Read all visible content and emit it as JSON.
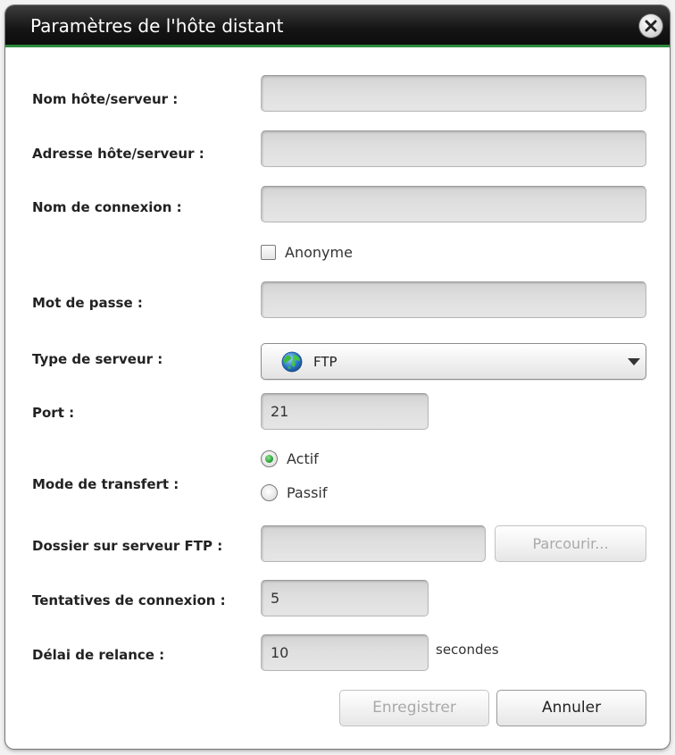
{
  "dialog": {
    "title": "Paramètres de l'hôte distant"
  },
  "form": {
    "host_name_label": "Nom hôte/serveur :",
    "host_name_value": "",
    "host_address_label": "Adresse hôte/serveur :",
    "host_address_value": "",
    "login_name_label": "Nom de connexion :",
    "login_name_value": "",
    "anonymous_label": "Anonyme",
    "anonymous_checked": false,
    "password_label": "Mot de passe :",
    "password_value": "",
    "server_type_label": "Type de serveur :",
    "server_type_value": "FTP",
    "port_label": "Port :",
    "port_value": "21",
    "transfer_mode_label": "Mode de transfert :",
    "transfer_mode_options": [
      "Actif",
      "Passif"
    ],
    "transfer_mode_selected": "Actif",
    "ftp_folder_label": "Dossier sur serveur FTP :",
    "ftp_folder_value": "",
    "browse_label": "Parcourir...",
    "retries_label": "Tentatives de connexion :",
    "retries_value": "5",
    "retry_delay_label": "Délai de relance :",
    "retry_delay_value": "10",
    "retry_delay_unit": "secondes"
  },
  "buttons": {
    "save_label": "Enregistrer",
    "cancel_label": "Annuler"
  },
  "colors": {
    "accent": "#2e8b3d",
    "titlebar": "#151515",
    "field_bg": "#dedede",
    "disabled_text": "#a9a9a9"
  },
  "icons": {
    "close": "close-icon",
    "server_type": "globe-icon",
    "dropdown": "chevron-down-icon"
  }
}
